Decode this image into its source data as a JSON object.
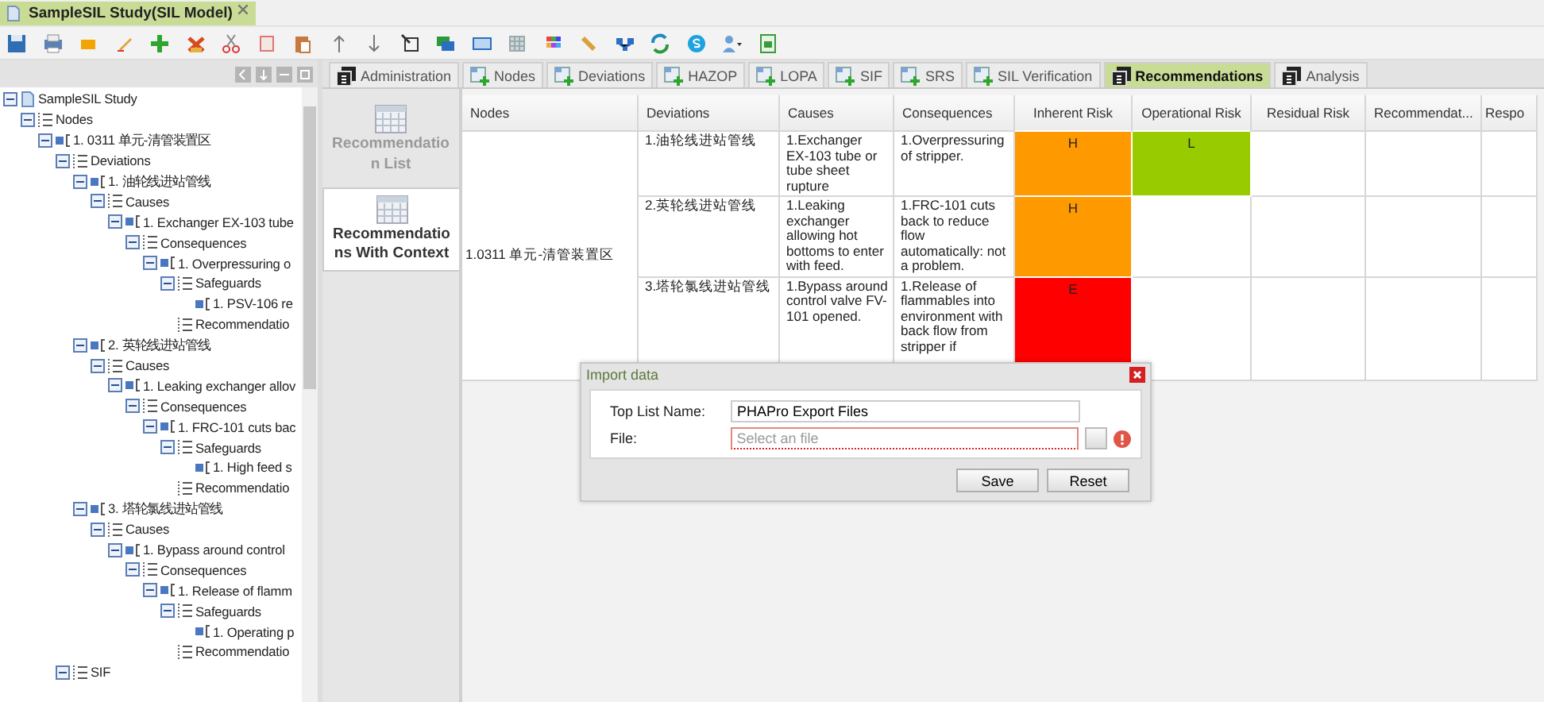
{
  "document_tab": {
    "title": "SampleSIL Study(SIL Model)",
    "selected": true
  },
  "tree": [
    {
      "label": "SampleSIL Study",
      "kind": "study",
      "expanded": true,
      "children": [
        {
          "label": "Nodes",
          "kind": "list",
          "expanded": true,
          "children": [
            {
              "label": "1. 0311 单元-清管装置区",
              "kind": "item",
              "expanded": true,
              "children": [
                {
                  "label": "Deviations",
                  "kind": "list",
                  "expanded": true,
                  "children": [
                    {
                      "label": "1. 油轮线进站管线",
                      "kind": "item",
                      "expanded": true,
                      "children": [
                        {
                          "label": "Causes",
                          "kind": "list",
                          "expanded": true,
                          "children": [
                            {
                              "label": "1. Exchanger EX-103 tube",
                              "kind": "item",
                              "expanded": true,
                              "children": [
                                {
                                  "label": "Consequences",
                                  "kind": "list",
                                  "expanded": true,
                                  "children": [
                                    {
                                      "label": "1. Overpressuring o",
                                      "kind": "item",
                                      "expanded": true,
                                      "children": [
                                        {
                                          "label": "Safeguards",
                                          "kind": "list",
                                          "expanded": true,
                                          "children": [
                                            {
                                              "label": "1. PSV-106 re",
                                              "kind": "item"
                                            }
                                          ]
                                        },
                                        {
                                          "label": "Recommendatio",
                                          "kind": "list"
                                        }
                                      ]
                                    }
                                  ]
                                }
                              ]
                            }
                          ]
                        }
                      ]
                    },
                    {
                      "label": "2. 英轮线进站管线",
                      "kind": "item",
                      "expanded": true,
                      "children": [
                        {
                          "label": "Causes",
                          "kind": "list",
                          "expanded": true,
                          "children": [
                            {
                              "label": "1. Leaking exchanger allov",
                              "kind": "item",
                              "expanded": true,
                              "children": [
                                {
                                  "label": "Consequences",
                                  "kind": "list",
                                  "expanded": true,
                                  "children": [
                                    {
                                      "label": "1. FRC-101 cuts bac",
                                      "kind": "item",
                                      "expanded": true,
                                      "children": [
                                        {
                                          "label": "Safeguards",
                                          "kind": "list",
                                          "expanded": true,
                                          "children": [
                                            {
                                              "label": "1. High feed s",
                                              "kind": "item"
                                            }
                                          ]
                                        },
                                        {
                                          "label": "Recommendatio",
                                          "kind": "list"
                                        }
                                      ]
                                    }
                                  ]
                                }
                              ]
                            }
                          ]
                        }
                      ]
                    },
                    {
                      "label": "3. 塔轮氯线进站管线",
                      "kind": "item",
                      "expanded": true,
                      "children": [
                        {
                          "label": "Causes",
                          "kind": "list",
                          "expanded": true,
                          "children": [
                            {
                              "label": "1. Bypass around control",
                              "kind": "item",
                              "expanded": true,
                              "children": [
                                {
                                  "label": "Consequences",
                                  "kind": "list",
                                  "expanded": true,
                                  "children": [
                                    {
                                      "label": "1. Release of flamm",
                                      "kind": "item",
                                      "expanded": true,
                                      "children": [
                                        {
                                          "label": "Safeguards",
                                          "kind": "list",
                                          "expanded": true,
                                          "children": [
                                            {
                                              "label": "1. Operating p",
                                              "kind": "item"
                                            }
                                          ]
                                        },
                                        {
                                          "label": "Recommendatio",
                                          "kind": "list"
                                        }
                                      ]
                                    }
                                  ]
                                }
                              ]
                            }
                          ]
                        }
                      ]
                    }
                  ]
                },
                {
                  "label": "SIF",
                  "kind": "list",
                  "expanded": true
                }
              ]
            }
          ]
        }
      ]
    }
  ],
  "tabs": [
    {
      "label": "Administration",
      "kind": "report",
      "selected": false
    },
    {
      "label": "Nodes",
      "kind": "grid",
      "selected": false
    },
    {
      "label": "Deviations",
      "kind": "grid",
      "selected": false
    },
    {
      "label": "HAZOP",
      "kind": "grid",
      "selected": false
    },
    {
      "label": "LOPA",
      "kind": "grid",
      "selected": false
    },
    {
      "label": "SIF",
      "kind": "grid",
      "selected": false
    },
    {
      "label": "SRS",
      "kind": "grid",
      "selected": false
    },
    {
      "label": "SIL Verification",
      "kind": "grid",
      "selected": false
    },
    {
      "label": "Recommendations",
      "kind": "report",
      "selected": true
    },
    {
      "label": "Analysis",
      "kind": "report",
      "selected": false
    }
  ],
  "reports": [
    {
      "label": "Recommendation List",
      "selected": false
    },
    {
      "label": "Recommendations With Context",
      "selected": true
    }
  ],
  "table": {
    "columns": [
      "Nodes",
      "Deviations",
      "Causes",
      "Consequences",
      "Inherent Risk",
      "Operational Risk",
      "Residual Risk",
      "Recommendat...",
      "Respo"
    ],
    "node": "1.0311 单元-清管装置区",
    "rows": [
      {
        "deviation": "1.油轮线进站管线",
        "cause": "1.Exchanger EX-103 tube or tube sheet rupture",
        "consequence": "1.Overpressuring of stripper.",
        "inherent_risk": {
          "text": "H",
          "color": "#ff9900"
        },
        "operational_risk": {
          "text": "L",
          "color": "#99cc00"
        }
      },
      {
        "deviation": "2.英轮线进站管线",
        "cause": "1.Leaking exchanger allowing hot bottoms to enter with feed.",
        "consequence": "1.FRC-101 cuts back to reduce flow automatically: not a problem.",
        "inherent_risk": {
          "text": "H",
          "color": "#ff9900"
        }
      },
      {
        "deviation": "3.塔轮氯线进站管线",
        "cause": "1.Bypass around control valve FV-101 opened.",
        "consequence": "1.Release of flammables into environment with back flow from stripper if",
        "inherent_risk": {
          "text": "E",
          "color": "#ff0000"
        }
      }
    ]
  },
  "dialog": {
    "title": "Import data",
    "fields": [
      {
        "label": "Top List Name:",
        "value": "PHAPro Export Files"
      },
      {
        "label": "File:",
        "placeholder": "Select an file",
        "invalid": true
      }
    ],
    "buttons": [
      "Save",
      "Reset"
    ]
  }
}
